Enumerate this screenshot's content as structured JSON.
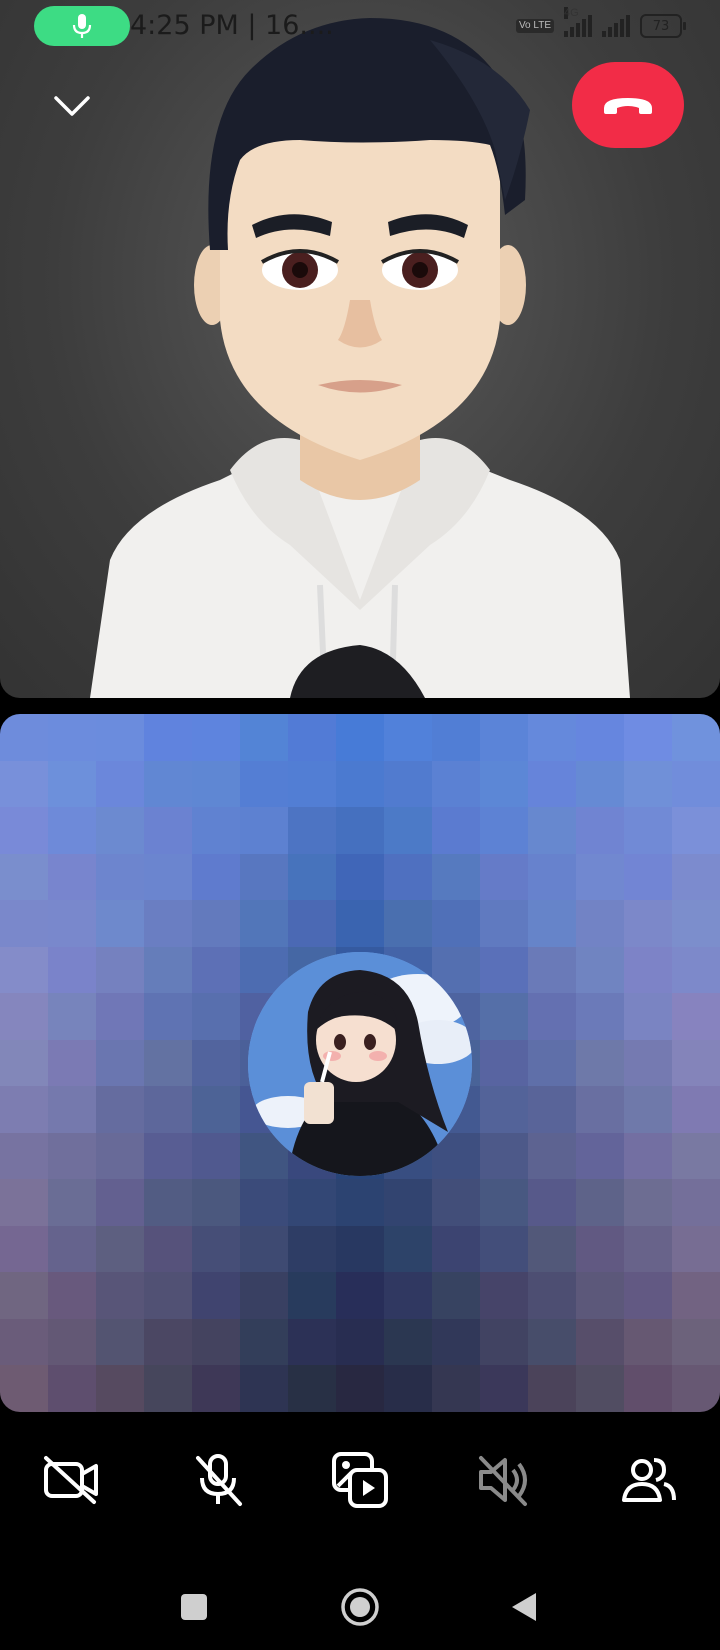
{
  "status_bar": {
    "time_text": "4:25 PM | 16....",
    "network_type": "4G",
    "volte_badge": "Vo LTE",
    "battery_level": "73",
    "mic_active_icon": "mic-icon"
  },
  "call": {
    "collapse_icon": "chevron-down-icon",
    "end_call_icon": "phone-hangup-icon"
  },
  "controls": [
    {
      "name": "camera-off-button",
      "icon": "video-off-icon"
    },
    {
      "name": "mute-mic-button",
      "icon": "mic-off-icon"
    },
    {
      "name": "share-media-button",
      "icon": "media-share-icon"
    },
    {
      "name": "speaker-off-button",
      "icon": "speaker-muted-icon"
    },
    {
      "name": "participants-button",
      "icon": "people-icon"
    }
  ],
  "nav": {
    "recents_icon": "square-icon",
    "home_icon": "circle-icon",
    "back_icon": "triangle-back-icon"
  },
  "colors": {
    "end_call": "#f22c47",
    "mic_pill": "#3ddc84"
  }
}
